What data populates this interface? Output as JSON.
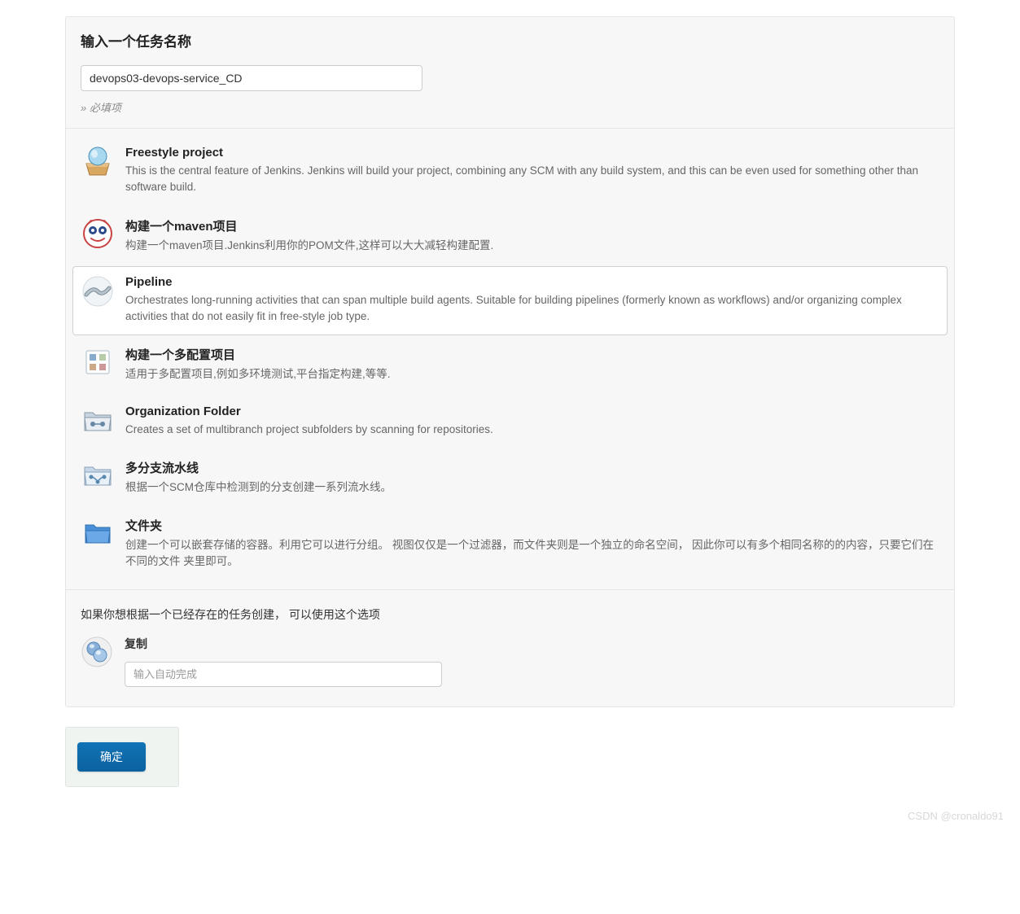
{
  "header": {
    "title": "输入一个任务名称",
    "name_value": "devops03-devops-service_CD",
    "required_hint": "» 必填项"
  },
  "items": [
    {
      "title": "Freestyle project",
      "desc": "This is the central feature of Jenkins. Jenkins will build your project, combining any SCM with any build system, and this can be even used for something other than software build.",
      "selected": false,
      "icon": "freestyle"
    },
    {
      "title": "构建一个maven项目",
      "desc": "构建一个maven项目.Jenkins利用你的POM文件,这样可以大大减轻构建配置.",
      "selected": false,
      "icon": "maven"
    },
    {
      "title": "Pipeline",
      "desc": "Orchestrates long-running activities that can span multiple build agents. Suitable for building pipelines (formerly known as workflows) and/or organizing complex activities that do not easily fit in free-style job type.",
      "selected": true,
      "icon": "pipeline"
    },
    {
      "title": "构建一个多配置项目",
      "desc": "适用于多配置项目,例如多环境测试,平台指定构建,等等.",
      "selected": false,
      "icon": "multiconfig"
    },
    {
      "title": "Organization Folder",
      "desc": "Creates a set of multibranch project subfolders by scanning for repositories.",
      "selected": false,
      "icon": "orgfolder"
    },
    {
      "title": "多分支流水线",
      "desc": "根据一个SCM仓库中检测到的分支创建一系列流水线。",
      "selected": false,
      "icon": "multibranch"
    },
    {
      "title": "文件夹",
      "desc": "创建一个可以嵌套存储的容器。利用它可以进行分组。 视图仅仅是一个过滤器，而文件夹则是一个独立的命名空间， 因此你可以有多个相同名称的的内容，只要它们在不同的文件 夹里即可。",
      "selected": false,
      "icon": "folder"
    }
  ],
  "copy": {
    "hint": "如果你想根据一个已经存在的任务创建， 可以使用这个选项",
    "label": "复制",
    "placeholder": "输入自动完成"
  },
  "footer": {
    "ok_label": "确定"
  },
  "watermark": "CSDN @cronaldo91"
}
